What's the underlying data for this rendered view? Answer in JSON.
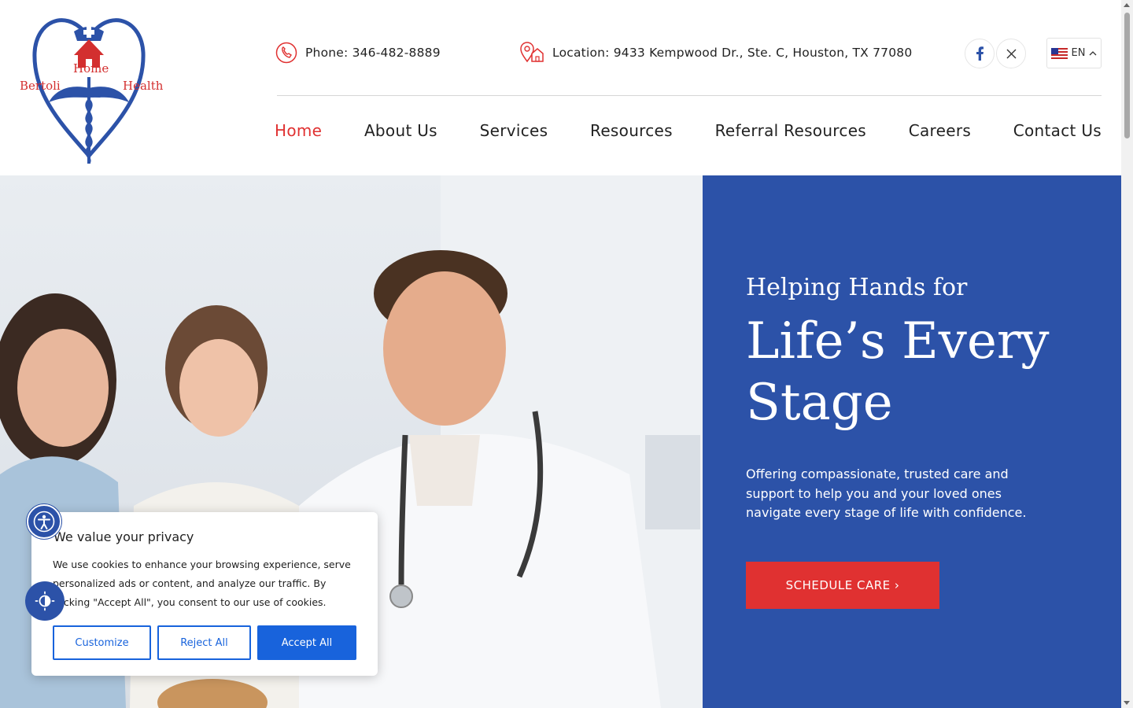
{
  "logo": {
    "top": "Home",
    "left": "Bertoli",
    "right": "Health"
  },
  "topbar": {
    "phone": "Phone: 346-482-8889",
    "location": "Location: 9433 Kempwood Dr., Ste. C, Houston, TX 77080",
    "lang": "EN"
  },
  "nav": [
    "Home",
    "About Us",
    "Services",
    "Resources",
    "Referral Resources",
    "Careers",
    "Contact Us"
  ],
  "hero": {
    "subtitle": "Helping Hands for",
    "title": "Life’s Every Stage",
    "description": "Offering compassionate, trusted care and support to help you and your loved ones navigate every stage of life with confidence.",
    "cta": "SCHEDULE CARE  ›"
  },
  "cookie": {
    "title": "We value your privacy",
    "text": "We use cookies to enhance your browsing experience, serve personalized ads or content, and analyze our traffic. By clicking \"Accept All\", you consent to our use of cookies.",
    "customize": "Customize",
    "reject": "Reject All",
    "accept": "Accept All"
  },
  "colors": {
    "brand_blue": "#2c52a8",
    "accent_red": "#e03131",
    "cookie_blue": "#1863dc"
  },
  "icons": [
    "phone-icon",
    "location-icon",
    "facebook-icon",
    "x-icon",
    "us-flag-icon",
    "chevron-up-icon",
    "accessibility-icon",
    "contrast-icon"
  ]
}
